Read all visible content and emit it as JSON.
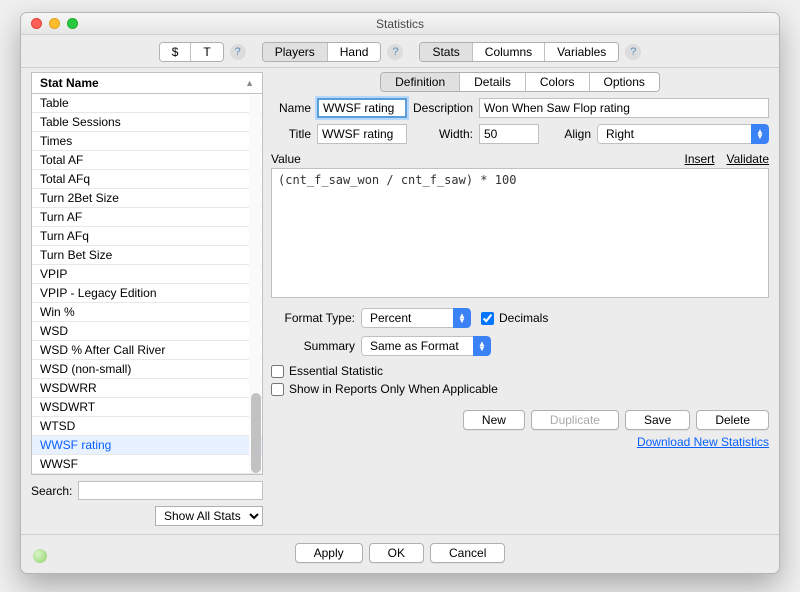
{
  "window": {
    "title": "Statistics"
  },
  "toolbar": {
    "group1": [
      "$",
      "T"
    ],
    "group2": [
      "Players",
      "Hand"
    ],
    "group3": [
      "Stats",
      "Columns",
      "Variables"
    ]
  },
  "left": {
    "header": "Stat Name",
    "items": [
      "Table",
      "Table Sessions",
      "Times",
      "Total AF",
      "Total AFq",
      "Turn 2Bet Size",
      "Turn AF",
      "Turn AFq",
      "Turn Bet Size",
      "VPIP",
      "VPIP - Legacy Edition",
      "Win %",
      "WSD",
      "WSD % After Call River",
      "WSD (non-small)",
      "WSDWRR",
      "WSDWRT",
      "WTSD",
      "WWSF rating",
      "WWSF"
    ],
    "selected": "WWSF rating",
    "search_label": "Search:",
    "search_value": "",
    "filter": "Show All Stats"
  },
  "tabs": {
    "items": [
      "Definition",
      "Details",
      "Colors",
      "Options"
    ],
    "active": "Definition"
  },
  "form": {
    "name_label": "Name",
    "name": "WWSF rating",
    "desc_label": "Description",
    "desc": "Won When Saw Flop rating",
    "title_label": "Title",
    "title_val": "WWSF rating",
    "width_label": "Width:",
    "width": "50",
    "align_label": "Align",
    "align": "Right",
    "value_label": "Value",
    "insert": "Insert",
    "validate": "Validate",
    "expression": "(cnt_f_saw_won / cnt_f_saw) * 100",
    "format_label": "Format Type:",
    "format": "Percent",
    "decimals_label": "Decimals",
    "decimals_checked": true,
    "summary_label": "Summary",
    "summary": "Same as Format",
    "essential_label": "Essential Statistic",
    "essential_checked": false,
    "applicable_label": "Show in Reports Only When Applicable",
    "applicable_checked": false
  },
  "buttons": {
    "new": "New",
    "duplicate": "Duplicate",
    "save": "Save",
    "delete": "Delete",
    "download": "Download New Statistics"
  },
  "footer": {
    "apply": "Apply",
    "ok": "OK",
    "cancel": "Cancel"
  }
}
